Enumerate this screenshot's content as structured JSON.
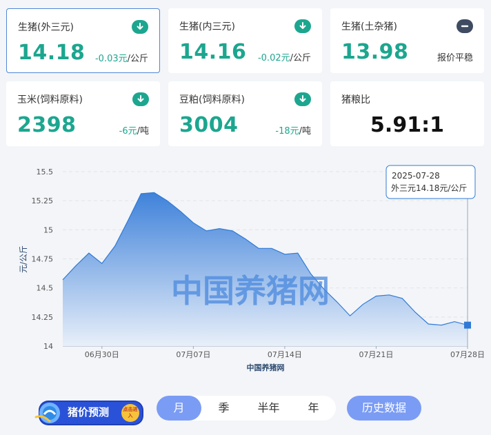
{
  "cards": [
    {
      "label": "生猪(外三元)",
      "price": "14.18",
      "change": "-0.03元",
      "unit": "/公斤",
      "badge": "down"
    },
    {
      "label": "生猪(内三元)",
      "price": "14.16",
      "change": "-0.02元",
      "unit": "/公斤",
      "badge": "down"
    },
    {
      "label": "生猪(土杂猪)",
      "price": "13.98",
      "flat": "报价平稳",
      "badge": "flat"
    },
    {
      "label": "玉米(饲料原料)",
      "price": "2398",
      "change": "-6元",
      "unit": "/吨",
      "badge": "down"
    },
    {
      "label": "豆粕(饲料原料)",
      "price": "3004",
      "change": "-18元",
      "unit": "/吨",
      "badge": "down"
    },
    {
      "label": "猪粮比",
      "ratio": "5.91:1"
    }
  ],
  "chart_data": {
    "type": "area",
    "ylabel": "元/公斤",
    "xlabel": "中国养猪网",
    "watermark": "中国养猪网",
    "ylim": [
      14,
      15.5
    ],
    "yticks": [
      "15.5",
      "15.25",
      "15",
      "14.75",
      "14.5",
      "14.25",
      "14"
    ],
    "xticks": [
      "06月30日",
      "07月07日",
      "07月14日",
      "07月21日",
      "07月28日"
    ],
    "x": [
      "06-27",
      "06-28",
      "06-29",
      "06-30",
      "07-01",
      "07-02",
      "07-03",
      "07-04",
      "07-05",
      "07-06",
      "07-07",
      "07-08",
      "07-09",
      "07-10",
      "07-11",
      "07-12",
      "07-13",
      "07-14",
      "07-15",
      "07-16",
      "07-17",
      "07-18",
      "07-19",
      "07-20",
      "07-21",
      "07-22",
      "07-23",
      "07-24",
      "07-25",
      "07-26",
      "07-27",
      "07-28"
    ],
    "values": [
      14.57,
      14.69,
      14.8,
      14.71,
      14.86,
      15.08,
      15.31,
      15.32,
      15.25,
      15.16,
      15.06,
      14.99,
      15.01,
      14.99,
      14.92,
      14.84,
      14.84,
      14.79,
      14.8,
      14.62,
      14.49,
      14.38,
      14.26,
      14.36,
      14.43,
      14.44,
      14.41,
      14.29,
      14.19,
      14.18,
      14.21,
      14.18
    ],
    "tooltip": {
      "date": "2025-07-28",
      "text": "外三元14.18元/公斤"
    },
    "colors": {
      "line": "#2f7ad6",
      "fill_top": "#3f82da",
      "fill_bottom": "#e8eff9",
      "grid": "#e3e3e3",
      "tick": "#555555",
      "marker": "#2f7ad6"
    }
  },
  "controls": {
    "predict_label": "猪价预测",
    "predict_badge": "点击进入",
    "periods": [
      "月",
      "季",
      "半年",
      "年"
    ],
    "active_period": "月",
    "history_label": "历史数据"
  }
}
